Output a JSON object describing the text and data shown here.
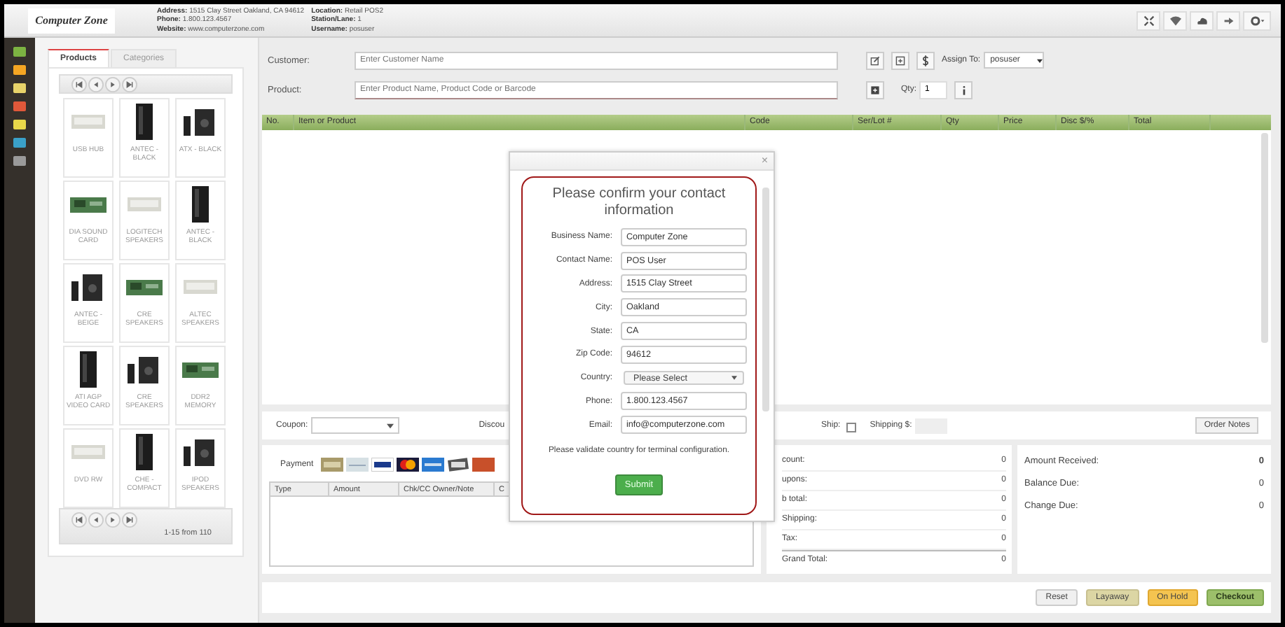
{
  "header": {
    "logo": "Computer Zone",
    "info": [
      {
        "label": "Address:",
        "value": "1515 Clay Street Oakland, CA 94612"
      },
      {
        "label": "Phone:",
        "value": "1.800.123.4567"
      },
      {
        "label": "Website:",
        "value": "www.computerzone.com"
      },
      {
        "label": "Location:",
        "value": "Retail POS2"
      },
      {
        "label": "Station/Lane:",
        "value": "1"
      },
      {
        "label": "Username:",
        "value": "posuser"
      }
    ]
  },
  "product_tabs": [
    {
      "label": "Products",
      "selected": true
    },
    {
      "label": "Categories",
      "selected": false
    }
  ],
  "products": [
    {
      "name": "USB HUB"
    },
    {
      "name": "ANTEC - BLACK"
    },
    {
      "name": "ATX - BLACK"
    },
    {
      "name": "DIA SOUND CARD"
    },
    {
      "name": "LOGITECH SPEAKERS"
    },
    {
      "name": "ANTEC - BLACK"
    },
    {
      "name": "ANTEC - BEIGE"
    },
    {
      "name": "CRE SPEAKERS"
    },
    {
      "name": "ALTEC SPEAKERS"
    },
    {
      "name": "ATI AGP VIDEO CARD"
    },
    {
      "name": "CRE SPEAKERS"
    },
    {
      "name": "DDR2 MEMORY"
    },
    {
      "name": "DVD RW"
    },
    {
      "name": "CHE - COMPACT"
    },
    {
      "name": "IPOD SPEAKERS"
    }
  ],
  "pager": {
    "range": "1-15 from 110"
  },
  "customer": {
    "label": "Customer:",
    "placeholder": "Enter Customer Name"
  },
  "assign": {
    "label": "Assign To:",
    "value": "posuser"
  },
  "product": {
    "label": "Product:",
    "placeholder": "Enter Product Name, Product Code or Barcode"
  },
  "qty": {
    "label": "Qty:",
    "value": "1"
  },
  "cart_columns": [
    "No.",
    "Item or Product",
    "Code",
    "Ser/Lot #",
    "Qty",
    "Price",
    "Disc $/%",
    "Total"
  ],
  "coupon": {
    "label": "Coupon:"
  },
  "discount_label": "Discou",
  "ship": {
    "label": "Ship:",
    "checked": false
  },
  "shipping": {
    "label": "Shipping $:"
  },
  "order_notes": "Order Notes",
  "payment": {
    "label": "Payment",
    "columns": [
      "Type",
      "Amount",
      "Chk/CC Owner/Note",
      "C"
    ]
  },
  "totals": [
    {
      "label": "count:",
      "value": "0"
    },
    {
      "label": "upons:",
      "value": "0"
    },
    {
      "label": "b total:",
      "value": "0"
    },
    {
      "label": "Shipping:",
      "value": "0"
    },
    {
      "label": "Tax:",
      "value": "0"
    },
    {
      "label": "Grand Total:",
      "value": "0"
    }
  ],
  "amounts": [
    {
      "label": "Amount Received:",
      "value": "0"
    },
    {
      "label": "Balance Due:",
      "value": "0"
    },
    {
      "label": "Change Due:",
      "value": "0"
    }
  ],
  "actions": [
    {
      "label": "Reset",
      "kind": "reset"
    },
    {
      "label": "Layaway",
      "kind": "layaway"
    },
    {
      "label": "On Hold",
      "kind": "hold"
    },
    {
      "label": "Checkout",
      "kind": "checkout"
    }
  ],
  "dialog": {
    "close": "×",
    "title": "Please confirm your contact information",
    "fields": [
      {
        "label": "Business Name:",
        "value": "Computer Zone",
        "kind": "text"
      },
      {
        "label": "Contact Name:",
        "value": "POS User",
        "kind": "text"
      },
      {
        "label": "Address:",
        "value": "1515 Clay Street",
        "kind": "text"
      },
      {
        "label": "City:",
        "value": "Oakland",
        "kind": "text"
      },
      {
        "label": "State:",
        "value": "CA",
        "kind": "text"
      },
      {
        "label": "Zip Code:",
        "value": "94612",
        "kind": "text"
      },
      {
        "label": "Country:",
        "value": "Please Select",
        "kind": "select"
      },
      {
        "label": "Phone:",
        "value": "1.800.123.4567",
        "kind": "text"
      },
      {
        "label": "Email:",
        "value": "info@computerzone.com",
        "kind": "text"
      }
    ],
    "note": "Please validate country for terminal configuration.",
    "submit": "Submit"
  }
}
